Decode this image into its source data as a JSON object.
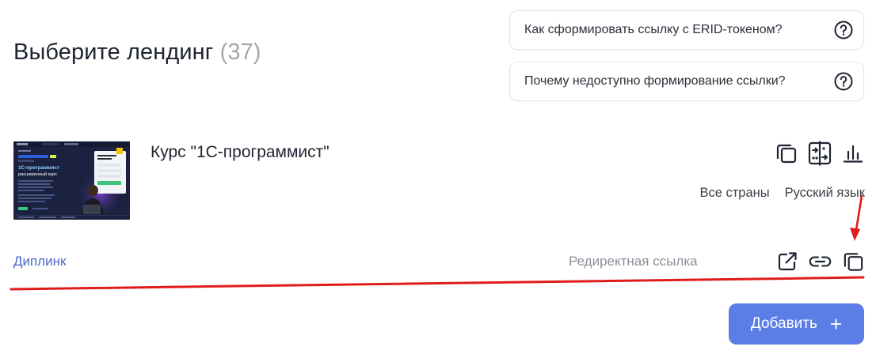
{
  "header": {
    "title": "Выберите лендинг",
    "count": "(37)"
  },
  "help": {
    "erid": "Как сформировать ссылку с ERID-токеном?",
    "unavailable": "Почему недоступно формирование ссылки?"
  },
  "landing": {
    "title": "Курс \"1С-программист\"",
    "countries": "Все страны",
    "language": "Русский язык",
    "deeplink_label": "Диплинк",
    "redirect_label": "Редиректная ссылка",
    "thumbnail": {
      "headline": "1С-программист",
      "subheadline": "расширенный курс"
    }
  },
  "actions": {
    "add_label": "Добавить"
  },
  "colors": {
    "accent": "#5a7ee6",
    "link": "#4a67c8",
    "annotation": "#e01b1b"
  }
}
